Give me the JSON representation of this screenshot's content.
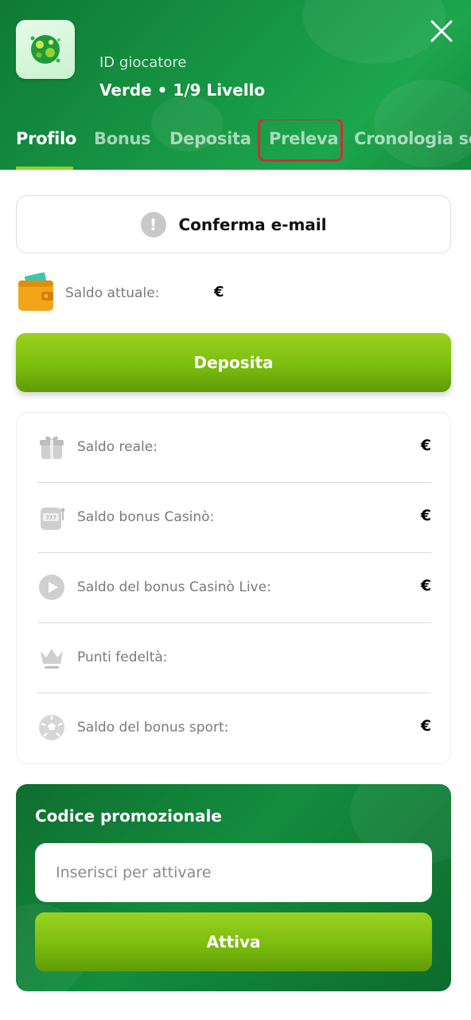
{
  "header": {
    "player_id_label": "ID giocatore",
    "level_text": "Verde • 1/9 Livello",
    "tabs": [
      {
        "label": "Profilo",
        "active": true
      },
      {
        "label": "Bonus",
        "active": false
      },
      {
        "label": "Deposita",
        "active": false
      },
      {
        "label": "Preleva",
        "active": false,
        "highlighted": true
      },
      {
        "label": "Cronologia so",
        "active": false
      }
    ],
    "colors": {
      "background": "#169443",
      "active_underline": "#8fd129",
      "highlight_border": "#d9283a"
    }
  },
  "confirm_email": {
    "label": "Conferma e-mail",
    "icon": "exclamation-icon"
  },
  "current_balance": {
    "label": "Saldo attuale:",
    "value": "€",
    "icon": "wallet-icon"
  },
  "deposit_button": {
    "label": "Deposita",
    "color": "#7cbd0e"
  },
  "balances": [
    {
      "label": "Saldo reale:",
      "value": "€",
      "icon": "gift-icon"
    },
    {
      "label": "Saldo bonus Casinò:",
      "value": "€",
      "icon": "slot-machine-icon"
    },
    {
      "label": "Saldo del bonus Casinò Live:",
      "value": "€",
      "icon": "play-icon"
    },
    {
      "label": "Punti fedeltà:",
      "value": "",
      "icon": "crown-icon"
    },
    {
      "label": "Saldo del bonus sport:",
      "value": "€",
      "icon": "soccer-ball-icon"
    }
  ],
  "promo": {
    "title": "Codice promozionale",
    "input_placeholder": "Inserisci per attivare",
    "input_value": "",
    "button_label": "Attiva"
  }
}
